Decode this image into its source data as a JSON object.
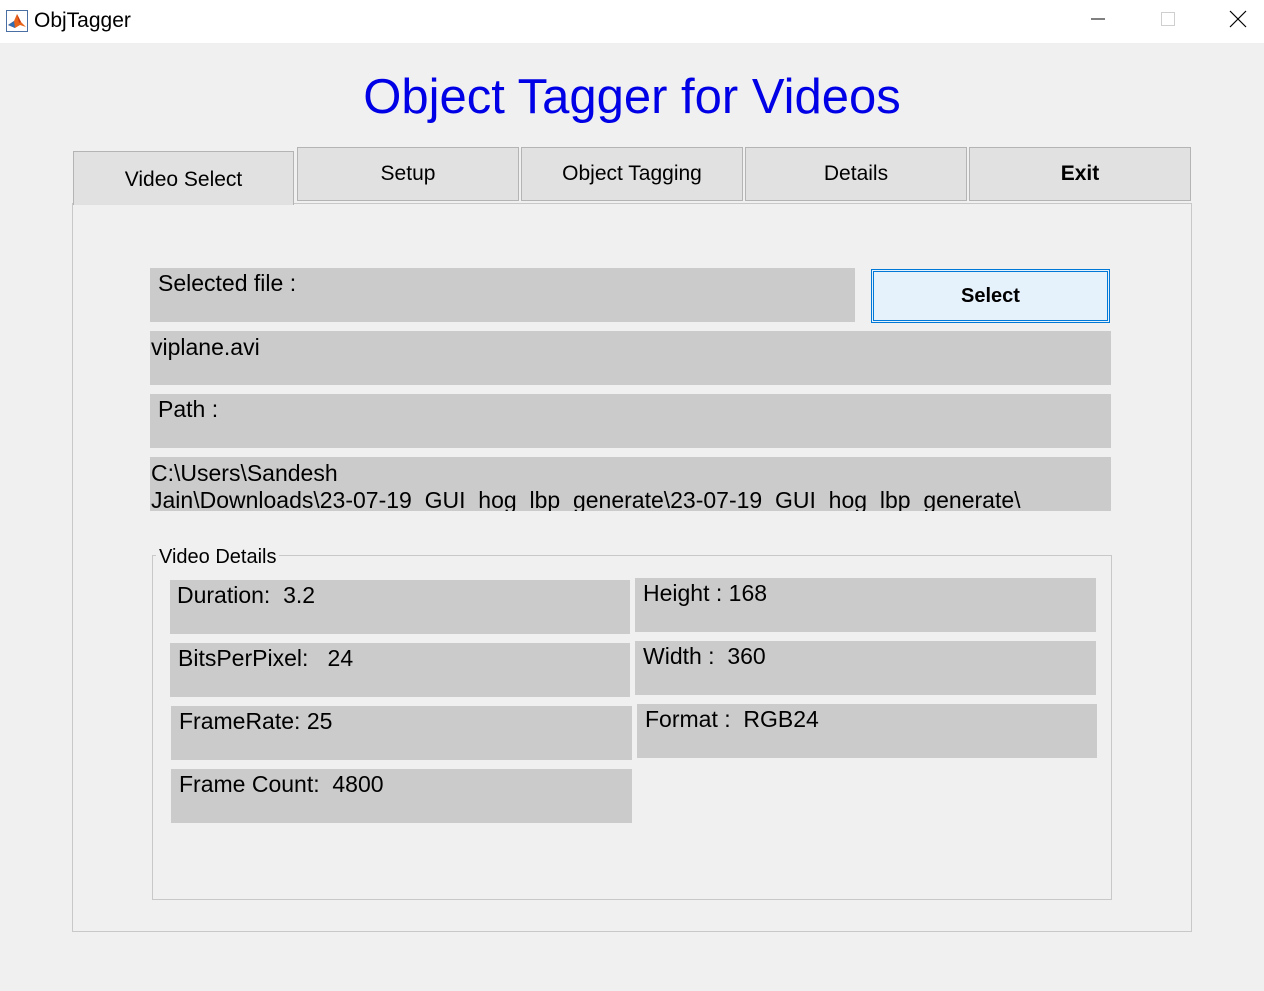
{
  "window": {
    "title": "ObjTagger"
  },
  "app": {
    "heading": "Object Tagger for Videos",
    "heading_color": "#0000e6"
  },
  "tabs": [
    {
      "label": "Video Select",
      "selected": true
    },
    {
      "label": "Setup",
      "selected": false
    },
    {
      "label": "Object Tagging",
      "selected": false
    },
    {
      "label": "Details",
      "selected": false
    },
    {
      "label": "Exit",
      "selected": false
    }
  ],
  "video_select": {
    "selected_file_label": "Selected file :",
    "select_button": "Select",
    "file_name": "viplane.avi",
    "path_label": "Path :",
    "path_line1": "C:\\Users\\Sandesh",
    "path_line2": "Jain\\Downloads\\23-07-19_GUI_hog_lbp_generate\\23-07-19_GUI_hog_lbp_generate\\"
  },
  "video_details": {
    "group_title": "Video Details",
    "duration": "Duration:  3.2",
    "height": "Height : 168",
    "bits_per_pixel": "BitsPerPixel:   24",
    "width": "Width :  360",
    "frame_rate": "FrameRate: 25",
    "format": "Format :  RGB24",
    "frame_count": "Frame Count:  4800"
  },
  "icons": {
    "app": "matlab-icon",
    "minimize": "minimize-icon",
    "maximize": "maximize-icon",
    "close": "close-icon"
  }
}
